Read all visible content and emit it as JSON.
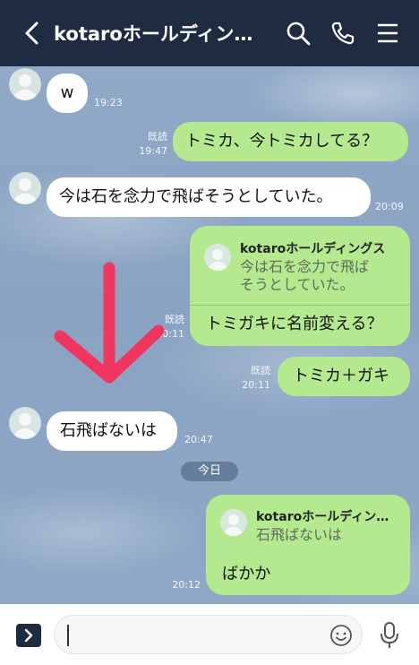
{
  "header": {
    "title": "kotaroホールディング…"
  },
  "messages": {
    "m1": {
      "text": "w",
      "time": "19:23"
    },
    "m2": {
      "text": "トミカ、今トミカしてる？",
      "read": "既読",
      "time": "19:47"
    },
    "m3": {
      "text": "今は石を念力で飛ばそうとしていた。",
      "time": "20:09"
    },
    "m4": {
      "quote_name": "kotaroホールディングス",
      "quote_line1": "今は石を念力で飛ば",
      "quote_line2": "そうとしていた。",
      "text": "トミガキに名前変える？",
      "read": "既読",
      "time": "20:11"
    },
    "m5": {
      "text": "トミカ＋ガキ",
      "read": "既読",
      "time": "20:11"
    },
    "m6": {
      "text": "石飛ばないは",
      "time": "20:47"
    },
    "m7": {
      "quote_name": "kotaroホールディン…",
      "quote_line1": "石飛ばないは",
      "text": "ばかか",
      "time": "20:12"
    }
  },
  "date_divider": "今日",
  "colors": {
    "header": "#1f2b40",
    "outgoing_bubble": "#b5e98f",
    "incoming_bubble": "#ffffff",
    "annotation_arrow": "#f2355e"
  },
  "icons": {
    "header": [
      "back-icon",
      "search-icon",
      "phone-icon",
      "menu-icon"
    ],
    "input": [
      "expand-icon",
      "emoji-icon",
      "microphone-icon"
    ]
  }
}
